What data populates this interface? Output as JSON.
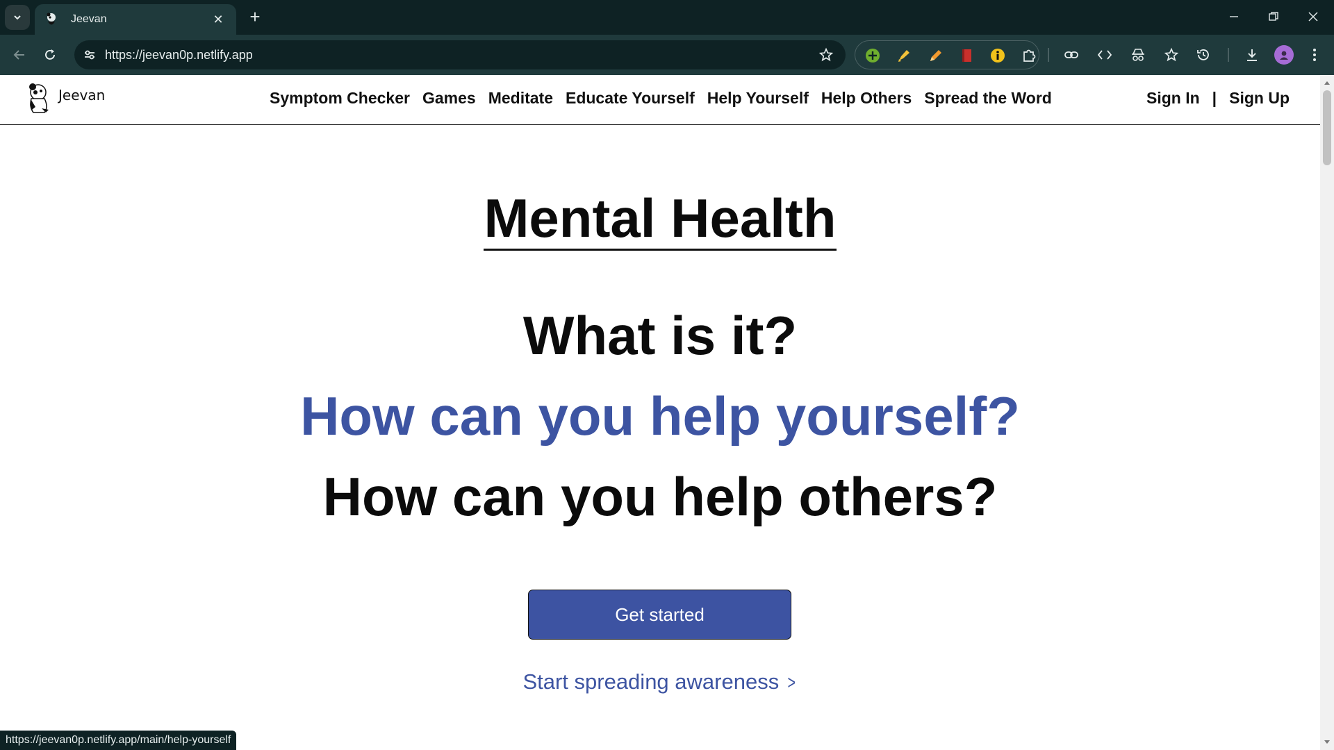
{
  "browser": {
    "tab_title": "Jeevan",
    "url": "https://jeevan0p.netlify.app",
    "status_url": "https://jeevan0p.netlify.app/main/help-yourself"
  },
  "site": {
    "brand": "Jeevan",
    "nav": [
      {
        "label": "Symptom Checker"
      },
      {
        "label": "Games"
      },
      {
        "label": "Meditate"
      },
      {
        "label": "Educate Yourself"
      },
      {
        "label": "Help Yourself"
      },
      {
        "label": "Help Others"
      },
      {
        "label": "Spread the Word"
      }
    ],
    "auth": {
      "sign_in": "Sign In",
      "separator": "|",
      "sign_up": "Sign Up"
    }
  },
  "hero": {
    "title": "Mental Health",
    "question_1": "What is it?",
    "question_2": "How can you help yourself?",
    "question_3": "How can you help others?",
    "cta": "Get started",
    "spread_link": "Start spreading awareness",
    "spread_chevron": ">"
  },
  "colors": {
    "accent": "#3d54a2",
    "chrome_dark": "#0e2224",
    "chrome_toolbar": "#1f3a3c"
  }
}
